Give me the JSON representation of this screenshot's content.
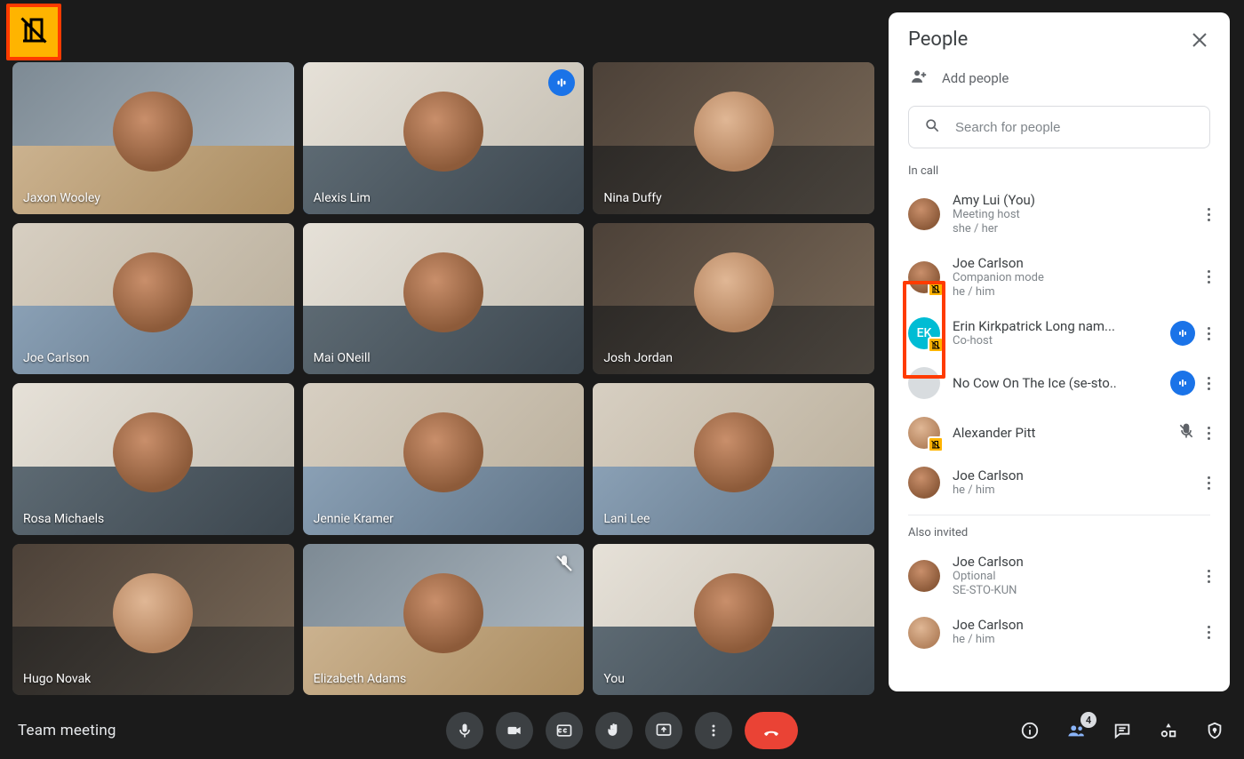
{
  "topLeftIcon": "domain-disabled-icon",
  "meetingTitle": "Team meeting",
  "peopleBadge": "4",
  "tiles": [
    {
      "name": "Jaxon Wooley",
      "active": false,
      "muted": false,
      "speaking": false,
      "variant": ""
    },
    {
      "name": "Alexis Lim",
      "active": true,
      "muted": false,
      "speaking": true,
      "variant": "variant-b"
    },
    {
      "name": "Nina Duffy",
      "active": false,
      "muted": false,
      "speaking": false,
      "variant": "variant-d"
    },
    {
      "name": "Joe Carlson",
      "active": false,
      "muted": false,
      "speaking": false,
      "variant": "variant-c"
    },
    {
      "name": "Mai ONeill",
      "active": false,
      "muted": false,
      "speaking": false,
      "variant": "variant-b"
    },
    {
      "name": "Josh Jordan",
      "active": false,
      "muted": false,
      "speaking": false,
      "variant": "variant-d"
    },
    {
      "name": "Rosa Michaels",
      "active": false,
      "muted": false,
      "speaking": false,
      "variant": "variant-b"
    },
    {
      "name": "Jennie Kramer",
      "active": false,
      "muted": false,
      "speaking": false,
      "variant": "variant-c"
    },
    {
      "name": "Lani Lee",
      "active": false,
      "muted": false,
      "speaking": false,
      "variant": "variant-c"
    },
    {
      "name": "Hugo Novak",
      "active": false,
      "muted": false,
      "speaking": false,
      "variant": "variant-d"
    },
    {
      "name": "Elizabeth Adams",
      "active": false,
      "muted": true,
      "speaking": false,
      "variant": ""
    },
    {
      "name": "You",
      "active": false,
      "muted": false,
      "speaking": false,
      "variant": "variant-b"
    }
  ],
  "panel": {
    "title": "People",
    "addLabel": "Add people",
    "searchPlaceholder": "Search for people",
    "sectionInCall": "In call",
    "sectionAlsoInvited": "Also invited",
    "inCall": [
      {
        "name": "Amy Lui (You)",
        "sub1": "Meeting host",
        "sub2": "she / her",
        "avatar": "photo",
        "badge": "",
        "status": ""
      },
      {
        "name": "Joe Carlson",
        "sub1": "Companion mode",
        "sub2": "he / him",
        "avatar": "photo",
        "badge": "companion",
        "status": ""
      },
      {
        "name": "Erin Kirkpatrick Long nam...",
        "sub1": "Co-host",
        "sub2": "",
        "avatar": "teal",
        "initials": "EK",
        "badge": "companion",
        "status": "speaking"
      },
      {
        "name": "No Cow On The Ice (se-sto..",
        "sub1": "",
        "sub2": "",
        "avatar": "gray",
        "badge": "",
        "status": "speaking"
      },
      {
        "name": "Alexander Pitt",
        "sub1": "",
        "sub2": "",
        "avatar": "photo2",
        "badge": "companion",
        "status": "muted"
      },
      {
        "name": "Joe Carlson",
        "sub1": "he / him",
        "sub2": "",
        "avatar": "photo",
        "badge": "",
        "status": ""
      }
    ],
    "alsoInvited": [
      {
        "name": "Joe Carlson",
        "sub1": "Optional",
        "sub2": "SE-STO-KUN",
        "avatar": "photo"
      },
      {
        "name": "Joe Carlson",
        "sub1": "he / him",
        "sub2": "",
        "avatar": "photo2"
      }
    ]
  }
}
